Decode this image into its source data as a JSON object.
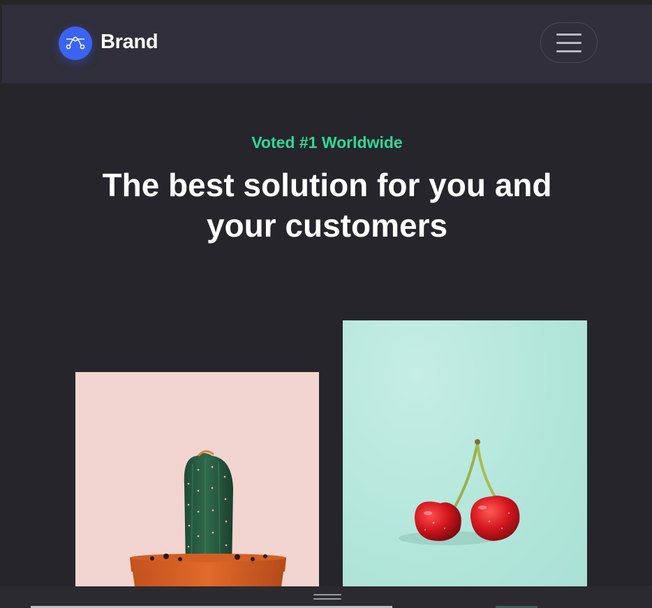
{
  "navbar": {
    "brand_label": "Brand",
    "brand_icon": "bezier-curve-icon",
    "menu_icon": "hamburger-menu-icon"
  },
  "hero": {
    "eyebrow": "Voted #1 Worldwide",
    "headline": "The best solution for you and your customers"
  },
  "gallery": [
    {
      "subject": "cactus-in-pot-image",
      "background": "#f2d5d0"
    },
    {
      "subject": "cherries-image",
      "background": "#b3e6db"
    }
  ],
  "colors": {
    "page_background": "#26252c",
    "navbar_background": "#302f3b",
    "brand_accent": "#3b63f2",
    "eyebrow_accent": "#2fd994",
    "headline_text": "#ffffff"
  }
}
